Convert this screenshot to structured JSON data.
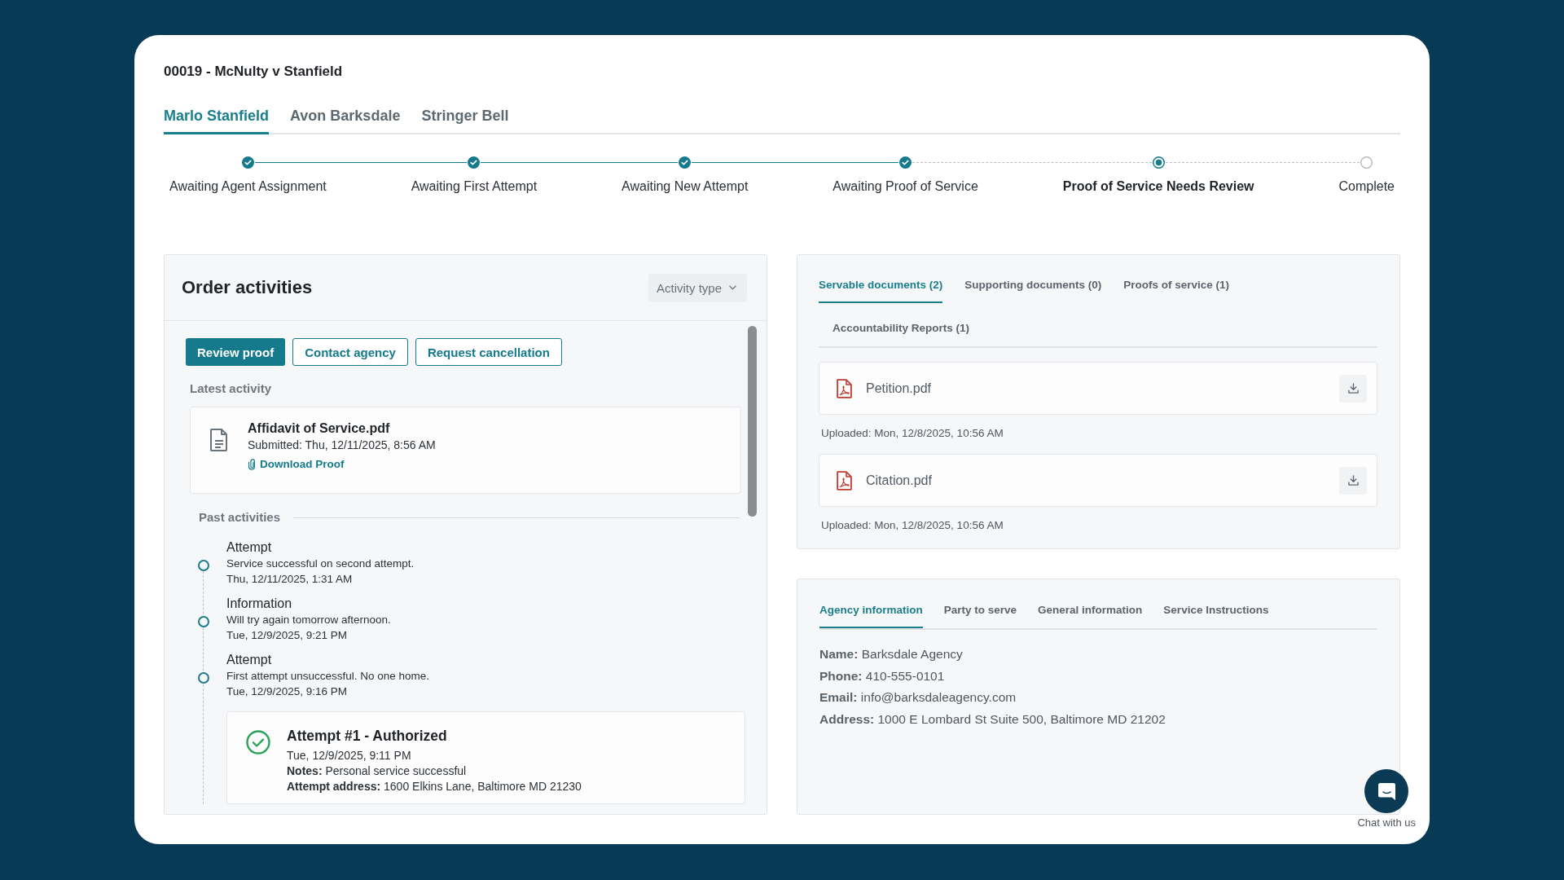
{
  "case": {
    "title": "00019 - McNulty v Stanfield"
  },
  "party_tabs": [
    {
      "label": "Marlo Stanfield",
      "selected": true
    },
    {
      "label": "Avon Barksdale",
      "selected": false
    },
    {
      "label": "Stringer Bell",
      "selected": false
    }
  ],
  "stepper": [
    {
      "label": "Awaiting Agent Assignment",
      "completed": true,
      "active": false
    },
    {
      "label": "Awaiting First Attempt",
      "completed": true,
      "active": false
    },
    {
      "label": "Awaiting New Attempt",
      "completed": true,
      "active": false
    },
    {
      "label": "Awaiting Proof of Service",
      "completed": true,
      "active": false
    },
    {
      "label": "Proof of Service Needs Review",
      "completed": false,
      "active": true
    },
    {
      "label": "Complete",
      "completed": false,
      "active": false
    }
  ],
  "activities": {
    "title": "Order activities",
    "filter": {
      "label": "Activity type"
    },
    "actions": [
      {
        "label": "Review proof",
        "kind": "primary"
      },
      {
        "label": "Contact agency",
        "kind": "outline"
      },
      {
        "label": "Request cancellation",
        "kind": "outline"
      }
    ],
    "latest_heading": "Latest activity",
    "latest": {
      "file": "Affidavit of Service.pdf",
      "submitted": "Submitted: Thu, 12/11/2025, 8:56 AM",
      "link": "Download Proof"
    },
    "past_heading": "Past activities",
    "past": [
      {
        "kind": "event",
        "title": "Attempt",
        "description": "Service successful on second attempt.",
        "time": "Thu, 12/11/2025, 1:31 AM"
      },
      {
        "kind": "event",
        "title": "Information",
        "description": "Will try again tomorrow afternoon.",
        "time": "Tue, 12/9/2025, 9:21 PM"
      },
      {
        "kind": "event",
        "title": "Attempt",
        "description": "First attempt unsuccessful. No one home.",
        "time": "Tue, 12/9/2025, 9:16 PM"
      },
      {
        "kind": "card",
        "title": "Attempt #1 - Authorized",
        "time": "Tue, 12/9/2025, 9:11 PM",
        "lines": [
          "**Notes:** Personal service successful",
          "**Attempt address:** 1600 Elkins Lane, Baltimore MD 21230"
        ]
      }
    ]
  },
  "documents": {
    "tabs": [
      {
        "label": "Servable documents (2)",
        "selected": true
      },
      {
        "label": "Supporting documents (0)",
        "selected": false
      },
      {
        "label": "Proofs of service (1)",
        "selected": false
      },
      {
        "label": "Accountability Reports (1)",
        "selected": false
      }
    ],
    "files": [
      {
        "name": "Petition.pdf",
        "uploaded": "Uploaded: Mon, 12/8/2025, 10:56 AM"
      },
      {
        "name": "Citation.pdf",
        "uploaded": "Uploaded: Mon, 12/8/2025, 10:56 AM"
      }
    ]
  },
  "details": {
    "tabs": [
      {
        "label": "Agency information",
        "selected": true
      },
      {
        "label": "Party to serve",
        "selected": false
      },
      {
        "label": "General information",
        "selected": false
      },
      {
        "label": "Service Instructions",
        "selected": false
      }
    ],
    "lines": [
      "**Name:** Barksdale Agency",
      "**Phone:** 410-555-0101",
      "**Email:** info@barksdaleagency.com",
      "**Address:** 1000 E Lombard St Suite 500, Baltimore MD 21202"
    ]
  },
  "chat": {
    "label": "Chat with us"
  }
}
